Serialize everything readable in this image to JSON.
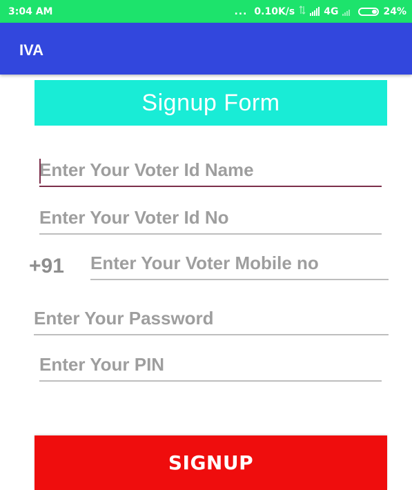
{
  "status_bar": {
    "time": "3:04 AM",
    "dots": "...",
    "speed": "0.10K/s",
    "network": "4G",
    "battery": "24%"
  },
  "app_bar": {
    "title": "IVA"
  },
  "form": {
    "title": "Signup Form",
    "voter_name_placeholder": "Enter Your Voter Id Name",
    "voter_id_placeholder": "Enter Your Voter Id No",
    "country_code": "+91",
    "mobile_placeholder": "Enter Your Voter Mobile no",
    "password_placeholder": "Enter Your Password",
    "pin_placeholder": "Enter Your PIN",
    "submit_label": "SIGNUP"
  },
  "colors": {
    "status_bar": "#1de36c",
    "app_bar": "#3247dd",
    "banner": "#19ecd6",
    "submit": "#ef0d0d",
    "focus_accent": "#7b2e4a"
  },
  "icons": [
    "data-transfer-icon",
    "signal-icon",
    "signal-weak-icon",
    "battery-icon"
  ]
}
